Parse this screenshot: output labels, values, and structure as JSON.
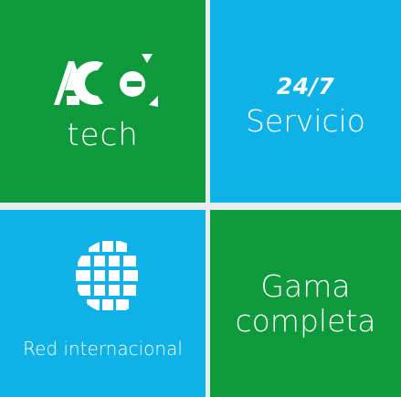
{
  "tiles": {
    "brand": {
      "logo_mark": "AC",
      "logo_sub": "tech",
      "color": "#0e9a3c"
    },
    "service": {
      "top": "24/7",
      "bottom": "Servicio",
      "color": "#0fb2e6"
    },
    "network": {
      "icon": "globe-icon",
      "label": "Red internacional",
      "color": "#0fb2e6"
    },
    "range": {
      "line1": "Gama",
      "line2": "completa",
      "color": "#0e9a3c"
    }
  }
}
